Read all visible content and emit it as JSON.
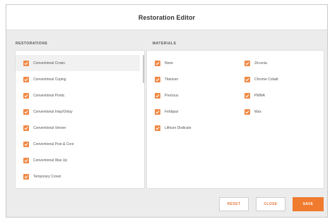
{
  "dialog": {
    "title": "Restoration Editor"
  },
  "restorations": {
    "header": "RESTORATIONS",
    "items": [
      {
        "label": "Conventional Crown",
        "checked": true,
        "selected": true
      },
      {
        "label": "Conventional Coping",
        "checked": true
      },
      {
        "label": "Conventional Pontic",
        "checked": true
      },
      {
        "label": "Conventional Inlay/Onlay",
        "checked": true
      },
      {
        "label": "Conventional Veneer",
        "checked": true
      },
      {
        "label": "Conventional Post & Core",
        "checked": true
      },
      {
        "label": "Conventional Wax Up",
        "checked": true
      },
      {
        "label": "Temporary Crown",
        "checked": true
      }
    ]
  },
  "materials": {
    "header": "MATERIALS",
    "items": [
      {
        "label": "None",
        "checked": true
      },
      {
        "label": "Zirconia",
        "checked": true
      },
      {
        "label": "Titanium",
        "checked": true
      },
      {
        "label": "Chrome Cobalt",
        "checked": true
      },
      {
        "label": "Precious",
        "checked": true
      },
      {
        "label": "PMMA",
        "checked": true
      },
      {
        "label": "Feldspar",
        "checked": true
      },
      {
        "label": "Wax",
        "checked": true
      },
      {
        "label": "Lithium Disilicate",
        "checked": true
      }
    ]
  },
  "buttons": {
    "reset": "RESET",
    "close": "CLOSE",
    "save": "SAVE"
  },
  "colors": {
    "accent": "#f07a2e",
    "checkbox": "#f08a47"
  }
}
